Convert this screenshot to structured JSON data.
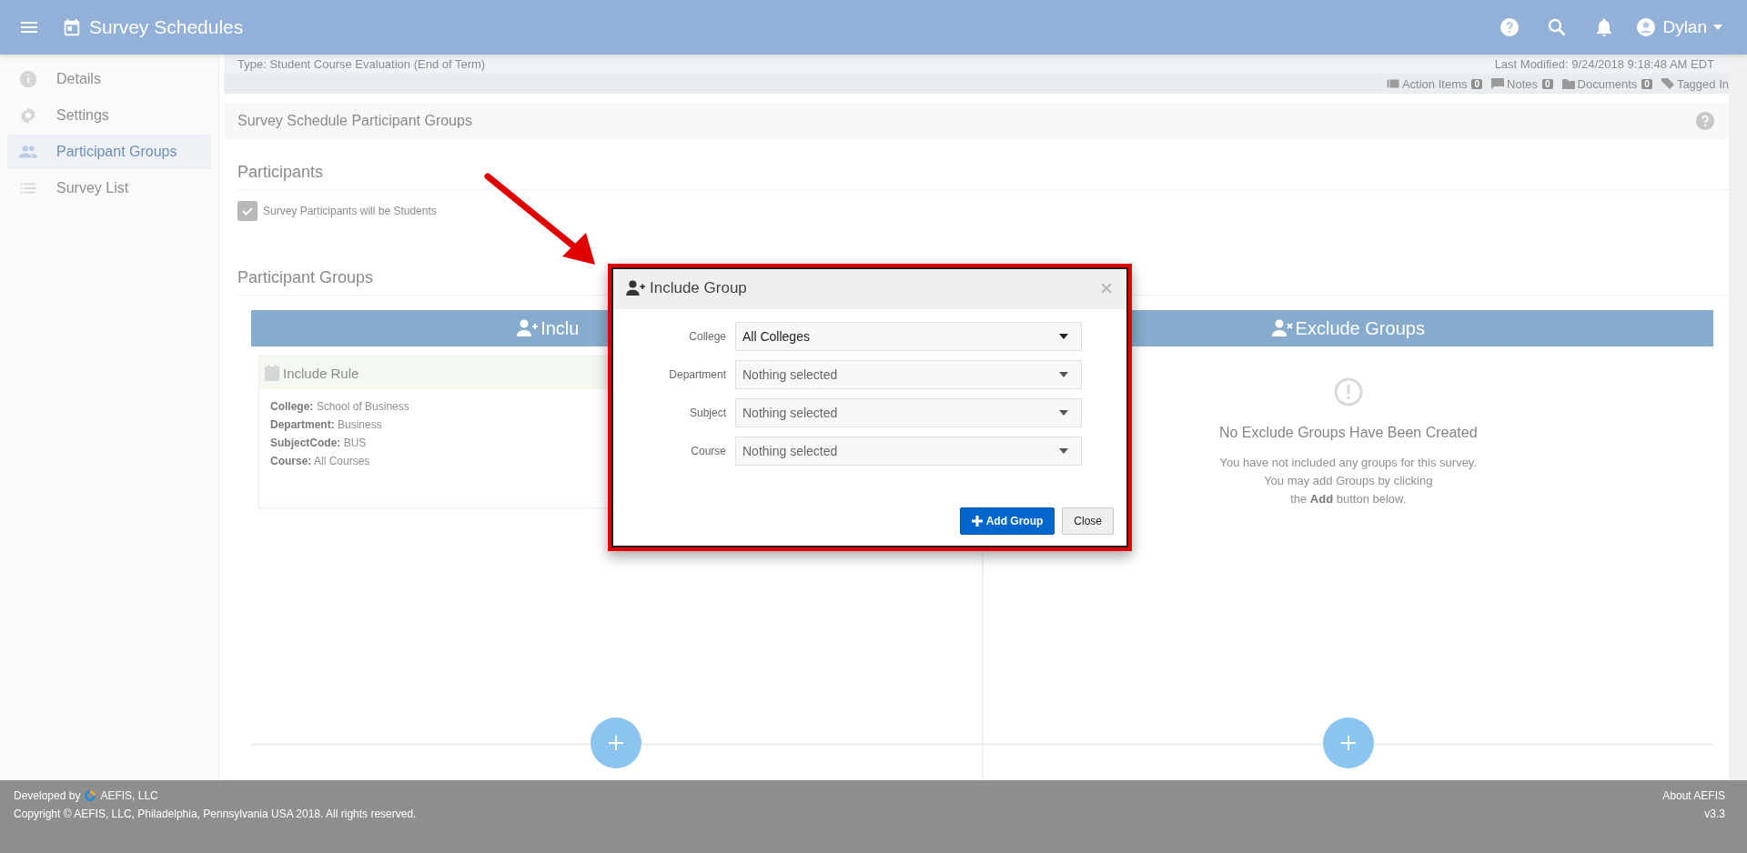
{
  "app_bar": {
    "title": "Survey Schedules",
    "user": "Dylan"
  },
  "sidebar": {
    "items": [
      {
        "label": "Details",
        "kind": "info",
        "selected": false
      },
      {
        "label": "Settings",
        "kind": "gear",
        "selected": false
      },
      {
        "label": "Participant Groups",
        "kind": "people",
        "selected": true
      },
      {
        "label": "Survey List",
        "kind": "list",
        "selected": false
      }
    ]
  },
  "record_strip": {
    "type_line": "Type: Student Course Evaluation (End of Term)",
    "last_modified": "Last Modified: 9/24/2018 9:18:48 AM EDT",
    "counters": [
      {
        "label": "Action Items",
        "count": "0",
        "kind": "items"
      },
      {
        "label": "Notes",
        "count": "0",
        "kind": "notes"
      },
      {
        "label": "Documents",
        "count": "0",
        "kind": "folder"
      },
      {
        "label": "Tagged In",
        "kind": "tag"
      }
    ]
  },
  "section_title": "Survey Schedule Participant Groups",
  "participants": {
    "heading": "Participants",
    "checkbox": {
      "label": "Survey Participants will be Students",
      "checked": true
    }
  },
  "participant_groups": {
    "heading": "Participant Groups",
    "include": {
      "header": "Inclu",
      "rules": [
        {
          "title": "Include Rule",
          "fields": [
            {
              "label": "College:",
              "value": "School of Business"
            },
            {
              "label": "Department:",
              "value": "Business"
            },
            {
              "label": "SubjectCode:",
              "value": "BUS"
            },
            {
              "label": "Course:",
              "value": "All Courses"
            }
          ]
        }
      ]
    },
    "exclude": {
      "header": "Exclude Groups",
      "empty_title": "No Exclude Groups Have Been Created",
      "empty_text": "You have not included any groups for this survey.\nYou may add Groups by clicking\nthe **Add** button below."
    }
  },
  "dialog": {
    "title": "Include Group",
    "fields": [
      {
        "label": "College",
        "value": "All Colleges"
      },
      {
        "label": "Department",
        "placeholder": "Nothing selected"
      },
      {
        "label": "Subject",
        "placeholder": "Nothing selected"
      },
      {
        "label": "Course",
        "placeholder": "Nothing selected"
      }
    ],
    "buttons": [
      {
        "label": "Add Group",
        "kind": "primary"
      },
      {
        "label": "Close",
        "kind": "default"
      }
    ]
  },
  "footer": {
    "developed_by": "Developed by",
    "company": "AEFIS, LLC",
    "copyright": "Copyright © AEFIS, LLC, Philadelphia, Pennsylvania USA 2018. All rights reserved.",
    "about": "About AEFIS",
    "version": "v3.3"
  }
}
